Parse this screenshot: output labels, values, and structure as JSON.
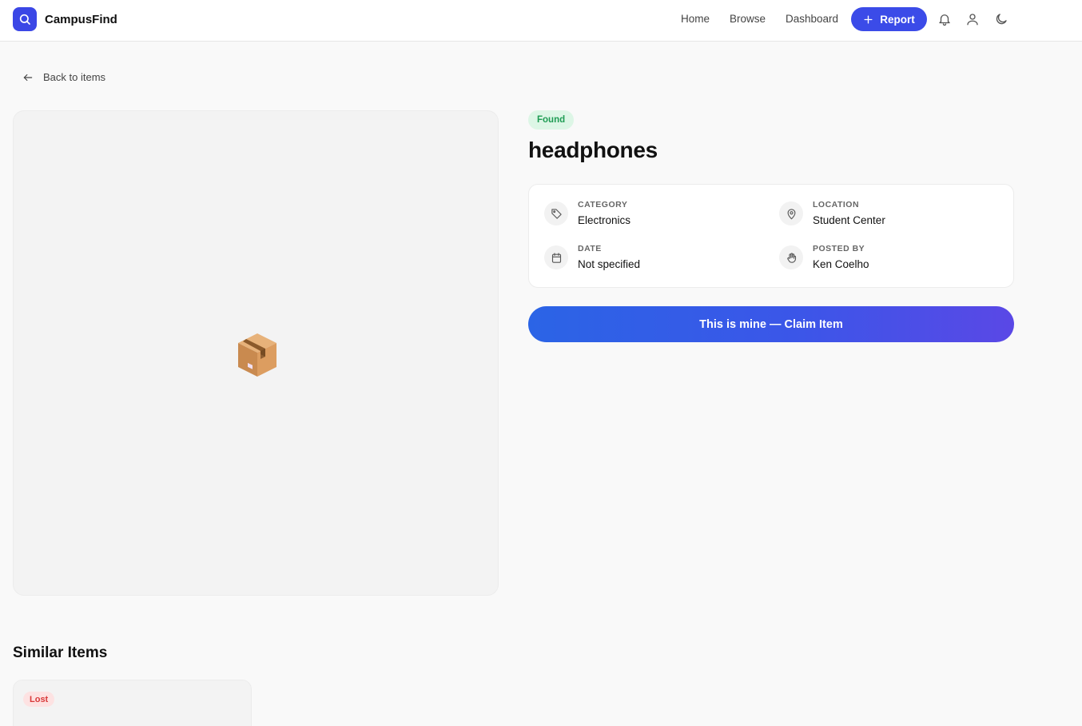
{
  "header": {
    "brand": "CampusFind",
    "nav": {
      "home": "Home",
      "browse": "Browse",
      "dashboard": "Dashboard"
    },
    "report_label": "Report",
    "icons": [
      "search-icon",
      "plus-icon",
      "bell-icon",
      "user-icon",
      "moon-icon"
    ]
  },
  "back_link": "Back to items",
  "item": {
    "status": "Found",
    "title": "headphones",
    "image_placeholder_icon": "package-icon",
    "details": {
      "category": {
        "label": "CATEGORY",
        "value": "Electronics",
        "icon": "tag-icon"
      },
      "location": {
        "label": "LOCATION",
        "value": "Student Center",
        "icon": "map-pin-icon"
      },
      "date": {
        "label": "DATE",
        "value": "Not specified",
        "icon": "calendar-icon"
      },
      "posted_by": {
        "label": "POSTED BY",
        "value": "Ken Coelho",
        "icon": "hand-icon"
      }
    },
    "claim_label": "This is mine — Claim Item"
  },
  "similar": {
    "title": "Similar Items",
    "items": [
      {
        "status": "Lost"
      }
    ]
  },
  "colors": {
    "accent": "#3b4be8",
    "found_bg": "#ddf6e6",
    "found_text": "#1f9c54",
    "lost_bg": "#fde2e2",
    "lost_text": "#d93a3a"
  }
}
